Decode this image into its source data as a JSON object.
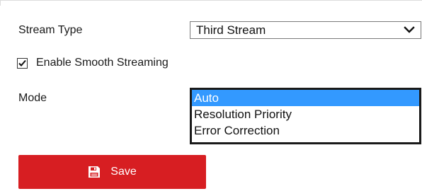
{
  "stream_type": {
    "label": "Stream Type",
    "selected": "Third Stream",
    "icon": "chevron-down-icon"
  },
  "smooth_streaming": {
    "label": "Enable Smooth Streaming",
    "checked": true
  },
  "mode": {
    "label": "Mode",
    "options": [
      "Auto",
      "Resolution Priority",
      "Error Correction"
    ],
    "selected": "Auto"
  },
  "save": {
    "label": "Save",
    "icon": "floppy-disk-icon"
  },
  "colors": {
    "accent": "#d71e22",
    "selection": "#3399ff",
    "text": "#1a1a1a"
  }
}
